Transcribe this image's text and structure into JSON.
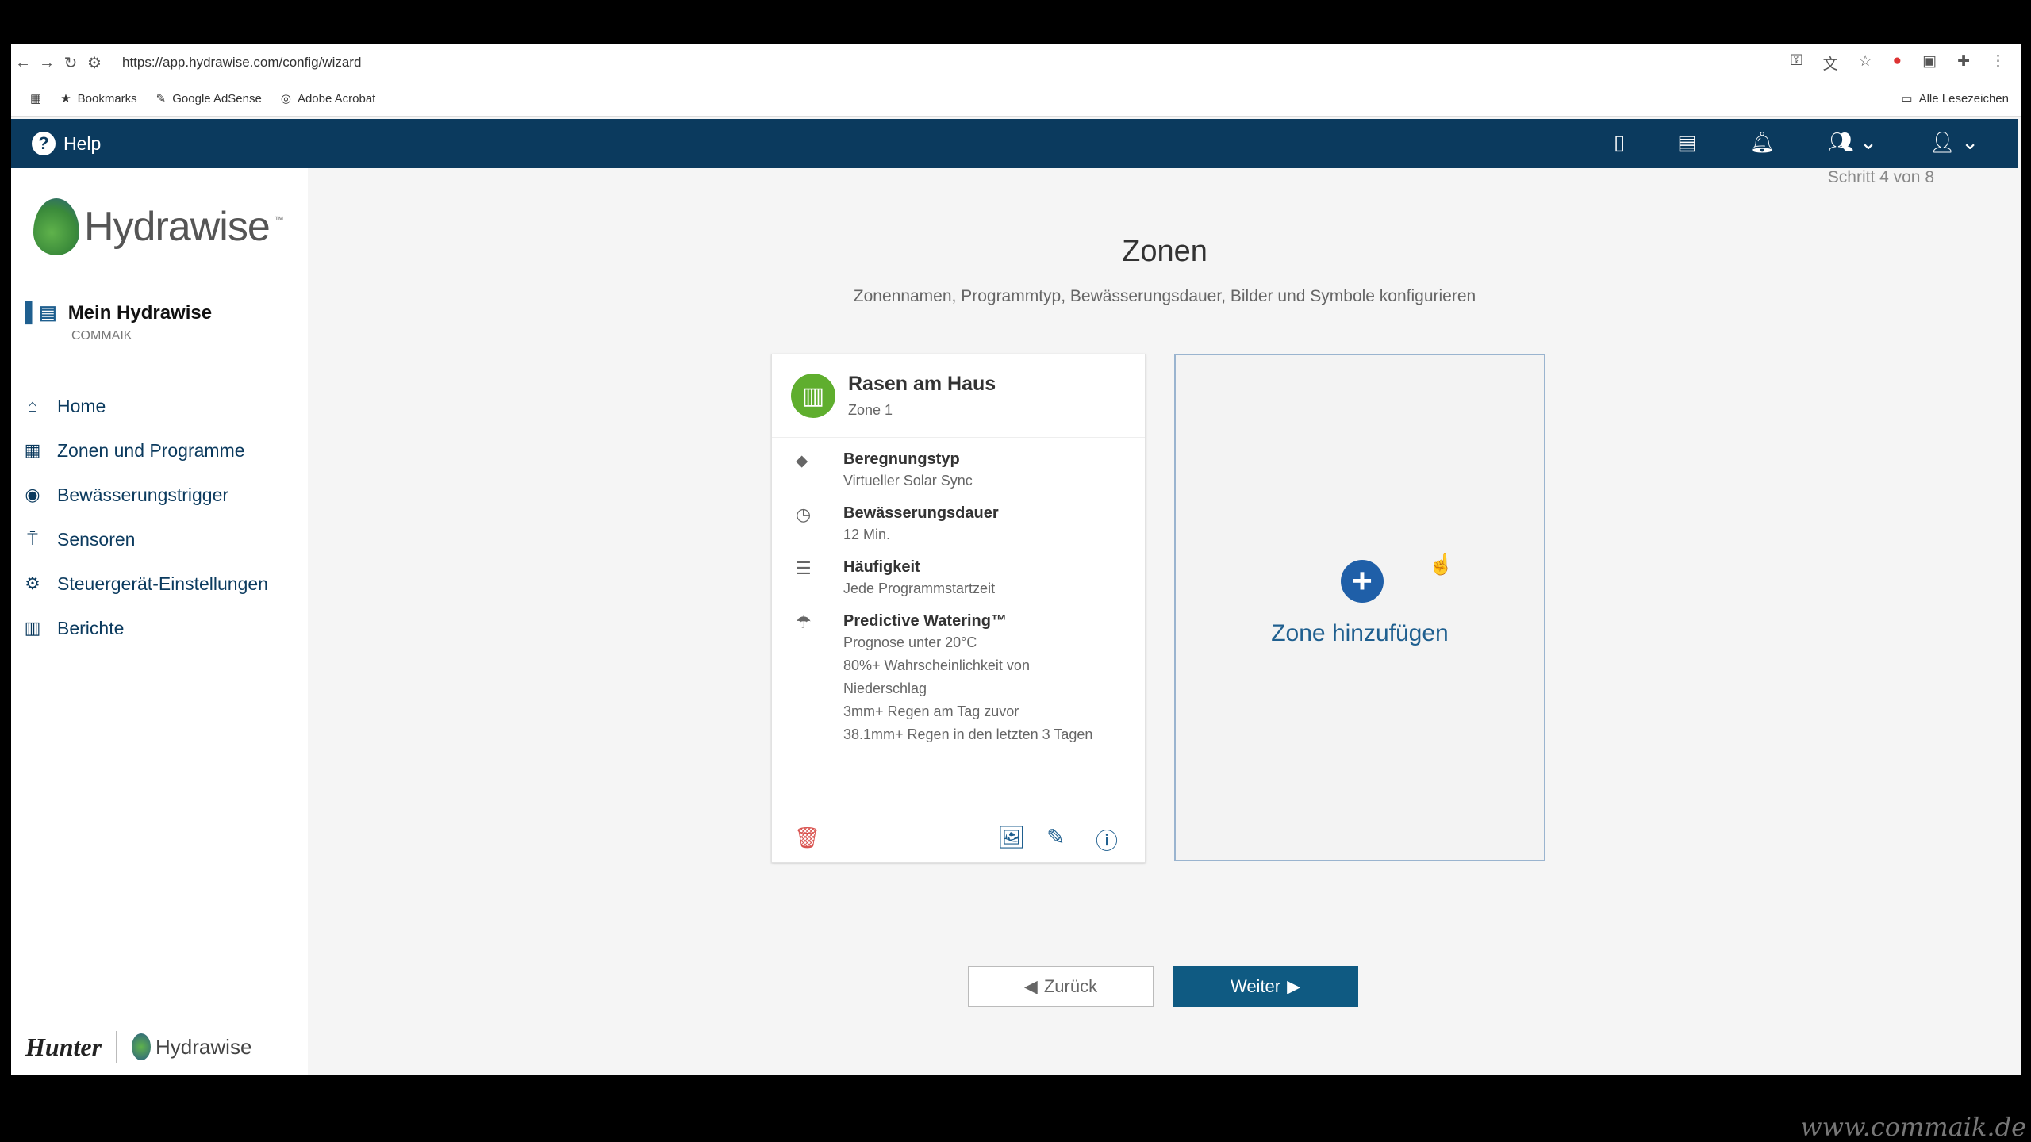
{
  "browser": {
    "url": "https://app.hydrawise.com/config/wizard",
    "bookmarks": [
      "Bookmarks",
      "Google AdSense",
      "Adobe Acrobat"
    ],
    "all_bookmarks": "Alle Lesezeichen"
  },
  "header": {
    "help": "Help"
  },
  "sidebar": {
    "brand": "Hydrawise",
    "account_title": "Mein Hydrawise",
    "account_sub": "COMMAIK",
    "items": [
      {
        "label": "Home"
      },
      {
        "label": "Zonen und Programme"
      },
      {
        "label": "Bewässerungstrigger"
      },
      {
        "label": "Sensoren"
      },
      {
        "label": "Steuergerät-Einstellungen"
      },
      {
        "label": "Berichte"
      }
    ],
    "footer_hunter": "Hunter",
    "footer_hydrawise": "Hydrawise"
  },
  "main": {
    "step": "Schritt 4 von 8",
    "title": "Zonen",
    "subtitle": "Zonennamen, Programmtyp, Bewässerungsdauer, Bilder und Symbole konfigurieren",
    "zone": {
      "name": "Rasen am Haus",
      "number": "Zone 1",
      "type_label": "Beregnungstyp",
      "type_value": "Virtueller Solar Sync",
      "duration_label": "Bewässerungsdauer",
      "duration_value": "12 Min.",
      "frequency_label": "Häufigkeit",
      "frequency_value": "Jede Programmstartzeit",
      "predictive_label": "Predictive Watering™",
      "predictive_lines": [
        "Prognose unter 20°C",
        "80%+ Wahrscheinlichkeit von",
        "Niederschlag",
        "3mm+ Regen am Tag zuvor",
        "38.1mm+ Regen in den letzten 3 Tagen"
      ]
    },
    "add_zone": "Zone hinzufügen",
    "back": "Zurück",
    "next": "Weiter"
  },
  "watermark": "www.commaik.de"
}
